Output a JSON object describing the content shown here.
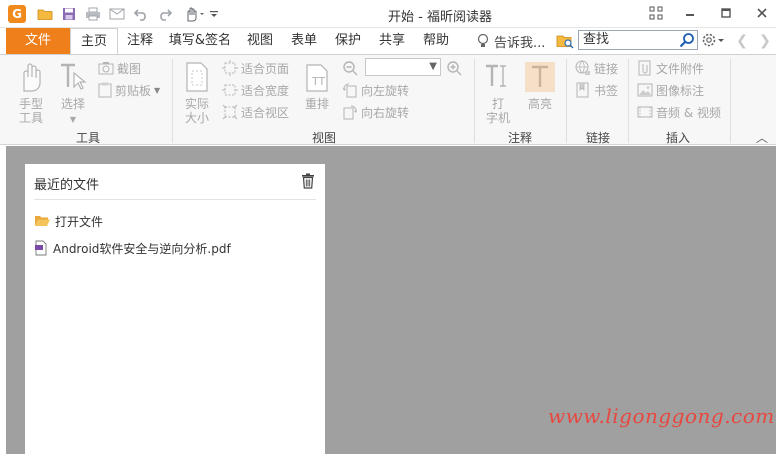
{
  "titlebar": {
    "app_logo": "G",
    "title": "开始 - 福昕阅读器",
    "quick_access_icons": [
      "open-folder-icon",
      "save-icon",
      "print-icon",
      "email-icon",
      "undo-icon",
      "redo-icon",
      "hand-tool-icon",
      "customize-dropdown-icon"
    ],
    "window_controls": [
      "ribbon-display-icon",
      "minimize-icon",
      "restore-icon",
      "close-icon"
    ]
  },
  "tabs": {
    "file": "文件",
    "items": [
      {
        "label": "主页",
        "active": true
      },
      {
        "label": "注释"
      },
      {
        "label": "填写&签名"
      },
      {
        "label": "视图"
      },
      {
        "label": "表单"
      },
      {
        "label": "保护"
      },
      {
        "label": "共享"
      },
      {
        "label": "帮助"
      }
    ],
    "tell_me": "告诉我...",
    "search": {
      "value": "查找"
    }
  },
  "ribbon": {
    "groups": {
      "tools": "工具",
      "view": "视图",
      "comment": "注释",
      "link": "链接",
      "insert": "插入"
    },
    "tools": {
      "hand_line1": "手型",
      "hand_line2": "工具",
      "select": "选择",
      "snapshot": "截图",
      "clipboard": "剪贴板"
    },
    "view": {
      "actual_line1": "实际",
      "actual_line2": "大小",
      "fit_page": "适合页面",
      "fit_width": "适合宽度",
      "fit_visible": "适合视区",
      "reflow": "重排",
      "zoom_value": "",
      "rotate_left": "向左旋转",
      "rotate_right": "向右旋转"
    },
    "comment": {
      "typewriter_line1": "打",
      "typewriter_line2": "字机",
      "highlight": "高亮"
    },
    "link": {
      "link": "链接",
      "bookmark": "书签"
    },
    "insert": {
      "file_attachment": "文件附件",
      "image_annotation": "图像标注",
      "audio_video": "音频 & 视频"
    }
  },
  "recent": {
    "title": "最近的文件",
    "open_file": "打开文件",
    "files": [
      "Android软件安全与逆向分析.pdf"
    ]
  },
  "watermark": "www.ligonggong.com",
  "colors": {
    "accent": "#ef7f1a",
    "workspace_bg": "#a0a0a0",
    "watermark": "#e8473f"
  }
}
